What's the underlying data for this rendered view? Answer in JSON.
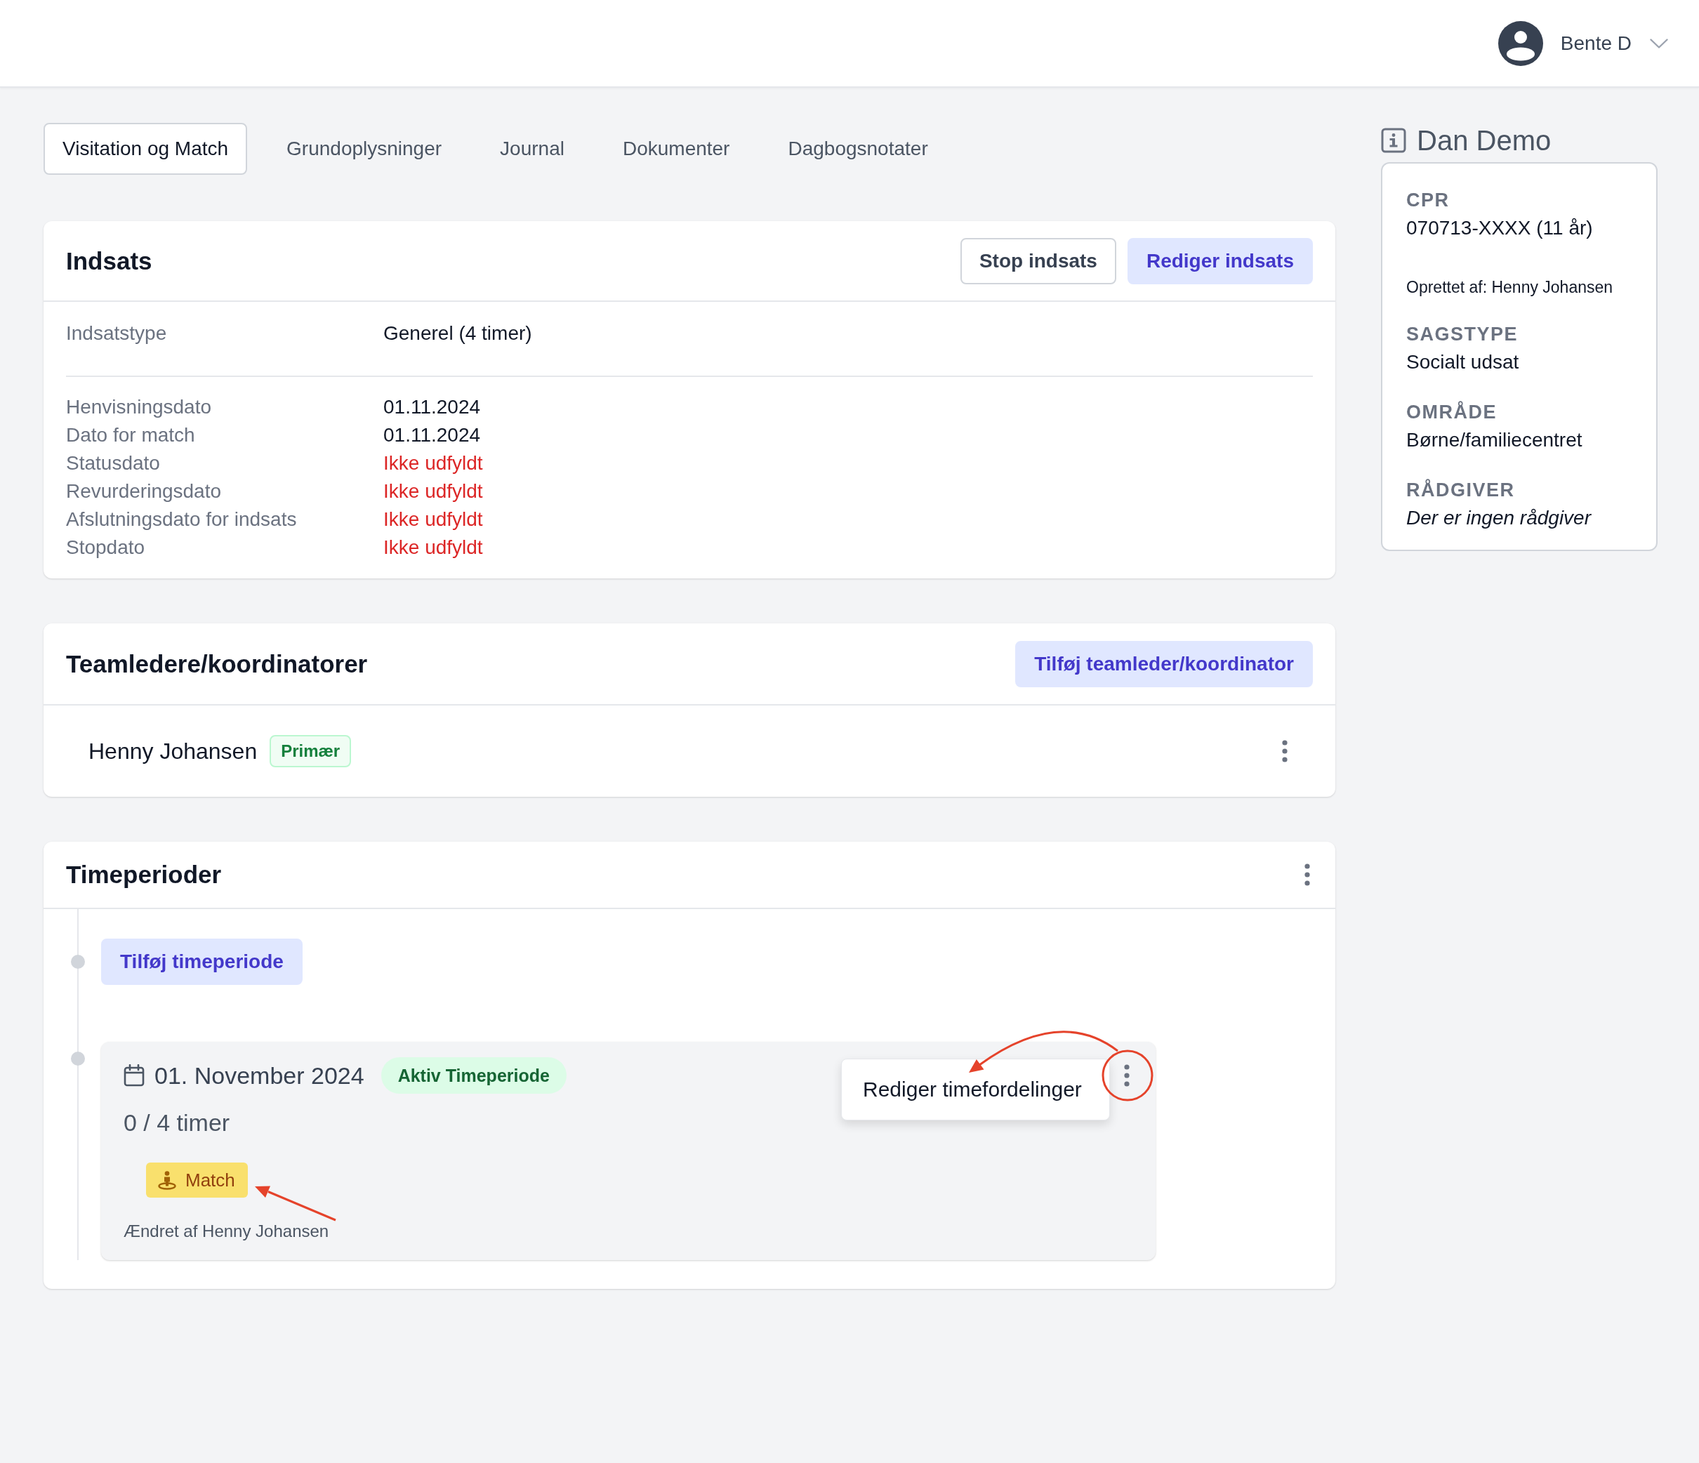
{
  "top_bar": {
    "user_name": "Bente D"
  },
  "tabs": [
    {
      "label": "Visitation og Match",
      "selected": true
    },
    {
      "label": "Grundoplysninger",
      "selected": false
    },
    {
      "label": "Journal",
      "selected": false
    },
    {
      "label": "Dokumenter",
      "selected": false
    },
    {
      "label": "Dagbogsnotater",
      "selected": false
    }
  ],
  "indsats": {
    "title": "Indsats",
    "buttons": [
      {
        "label": "Stop indsats",
        "kind": "outline"
      },
      {
        "label": "Rediger indsats",
        "kind": "primary"
      }
    ],
    "type": {
      "label": "Indsatstype",
      "value": "Generel (4 timer)"
    },
    "dates": [
      {
        "label": "Henvisningsdato",
        "value": "01.11.2024",
        "missing": false
      },
      {
        "label": "Dato for match",
        "value": "01.11.2024",
        "missing": false
      },
      {
        "label": "Statusdato",
        "value": "Ikke udfyldt",
        "missing": true
      },
      {
        "label": "Revurderingsdato",
        "value": "Ikke udfyldt",
        "missing": true
      },
      {
        "label": "Afslutningsdato for indsats",
        "value": "Ikke udfyldt",
        "missing": true
      },
      {
        "label": "Stopdato",
        "value": "Ikke udfyldt",
        "missing": true
      }
    ]
  },
  "teamledere": {
    "title": "Teamledere/koordinatorer",
    "button": "Tilføj teamleder/koordinator",
    "members": [
      {
        "name": "Henny Johansen",
        "badge": "Primær"
      }
    ]
  },
  "timeperioder": {
    "title": "Timeperioder",
    "add_button": "Tilføj timeperiode",
    "periods": [
      {
        "date": "01. November 2024",
        "status": "Aktiv Timeperiode",
        "hours": "0 / 4 timer",
        "tags": [
          "Match"
        ],
        "changed_by": "Ændret af Henny Johansen",
        "menu": {
          "open": true,
          "items": [
            "Rediger timefordelinger"
          ]
        }
      }
    ]
  },
  "sidebar": {
    "title": "Dan Demo",
    "items": [
      {
        "kind": "field",
        "label": "CPR",
        "value": "070713-XXXX (11 år)"
      },
      {
        "kind": "note",
        "value": "Oprettet af: Henny Johansen"
      },
      {
        "kind": "field",
        "label": "SAGSTYPE",
        "value": "Socialt udsat"
      },
      {
        "kind": "field",
        "label": "OMRÅDE",
        "value": "Børne/familiecentret"
      },
      {
        "kind": "empty",
        "label": "RÅDGIVER",
        "value": "Der er ingen rådgiver"
      }
    ]
  }
}
